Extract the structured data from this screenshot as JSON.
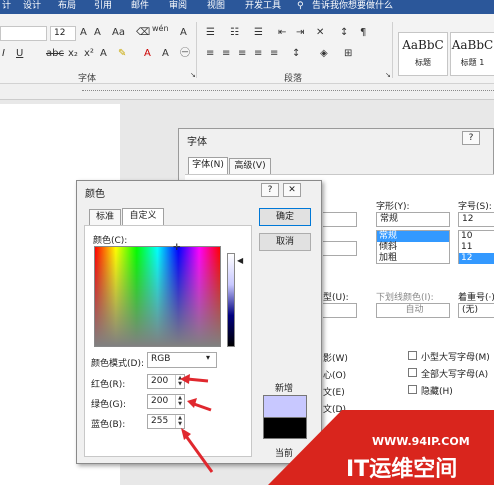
{
  "ribbon_tabs": [
    "计",
    "设计",
    "布局",
    "引用",
    "邮件",
    "审阅",
    "视图",
    "开发工具"
  ],
  "tell_me": "告诉我你想要做什么",
  "font_size_box": "12",
  "font_group_label": "字体",
  "paragraph_group_label": "段落",
  "styles": [
    {
      "sample": "AaBbC",
      "name": "标题"
    },
    {
      "sample": "AaBbC",
      "name": "标题 1"
    }
  ],
  "font_dialog": {
    "title": "字体",
    "help": "?",
    "tabs": [
      "字体(N)",
      "高级(V)"
    ],
    "style_label": "字形(Y):",
    "style_value": "常规",
    "style_list": [
      "常规",
      "倾斜",
      "加粗"
    ],
    "size_label": "字号(S):",
    "size_value": "12",
    "size_list": [
      "10",
      "11",
      "12"
    ],
    "underline_label": "型(U):",
    "underline_color_label": "下划线颜色(I):",
    "underline_color_value": "自动",
    "emphasis_label": "着重号(·)",
    "emphasis_value": "(无)",
    "effects": [
      {
        "label": "影(W)"
      },
      {
        "label": "心(O)"
      },
      {
        "label": "文(E)"
      },
      {
        "label": "文(D)"
      }
    ],
    "effects_right": [
      "小型大写字母(M)",
      "全部大写字母(A)",
      "隐藏(H)"
    ]
  },
  "color_dialog": {
    "title": "颜色",
    "help": "?",
    "close": "✕",
    "tabs": [
      "标准",
      "自定义"
    ],
    "colors_label": "颜色(C):",
    "model_label": "颜色模式(D):",
    "model_value": "RGB",
    "red_label": "红色(R):",
    "red_value": "200",
    "green_label": "绿色(G):",
    "green_value": "200",
    "blue_label": "蓝色(B):",
    "blue_value": "255",
    "ok": "确定",
    "cancel": "取消",
    "new_label": "新增",
    "current_label": "当前",
    "new_color": "#c8c8ff",
    "current_color": "#000000"
  },
  "watermark": {
    "url": "WWW.94IP.COM",
    "brand": "IT运维空间"
  }
}
